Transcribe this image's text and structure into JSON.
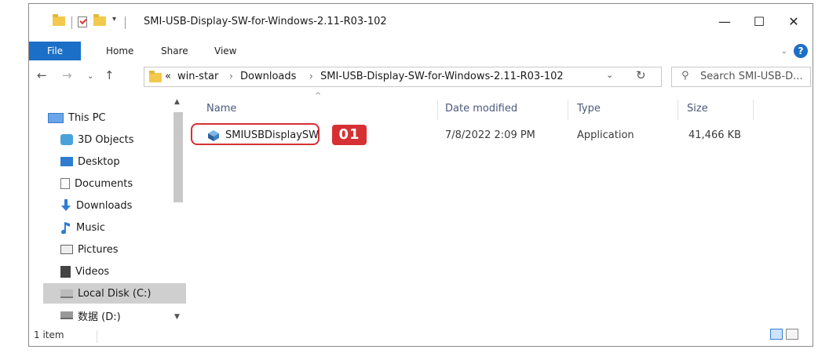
{
  "window": {
    "title": "SMI-USB-Display-SW-for-Windows-2.11-R03-102",
    "controls": {
      "minimize": "—",
      "maximize": "☐",
      "close": "✕"
    }
  },
  "ribbon": {
    "tabs": [
      "File",
      "Home",
      "Share",
      "View"
    ]
  },
  "address": {
    "prefix": "«",
    "crumbs": [
      "win-star",
      "Downloads",
      "SMI-USB-Display-SW-for-Windows-2.11-R03-102"
    ],
    "search_placeholder": "Search SMI-USB-D..."
  },
  "nav_pane": {
    "items": [
      {
        "label": "This PC",
        "icon": "computer-icon"
      },
      {
        "label": "3D Objects",
        "icon": "cube-icon"
      },
      {
        "label": "Desktop",
        "icon": "desktop-icon"
      },
      {
        "label": "Documents",
        "icon": "document-icon"
      },
      {
        "label": "Downloads",
        "icon": "download-arrow-icon"
      },
      {
        "label": "Music",
        "icon": "music-note-icon"
      },
      {
        "label": "Pictures",
        "icon": "picture-icon"
      },
      {
        "label": "Videos",
        "icon": "film-icon"
      },
      {
        "label": "Local Disk (C:)",
        "icon": "disk-icon",
        "selected": true
      },
      {
        "label": "数据 (D:)",
        "icon": "drive-icon"
      }
    ]
  },
  "file_list": {
    "columns": [
      "Name",
      "Date modified",
      "Type",
      "Size"
    ],
    "rows": [
      {
        "name": "SMIUSBDisplaySW",
        "date": "7/8/2022 2:09 PM",
        "type": "Application",
        "size": "41,466 KB",
        "icon": "application-icon"
      }
    ]
  },
  "annotation": {
    "badge": "01",
    "color": "#d63033"
  },
  "status": {
    "count": "1 item"
  },
  "colors": {
    "accent": "#1c6fc7",
    "highlight": "#d63033",
    "selected_bg": "#cfcfcf"
  }
}
